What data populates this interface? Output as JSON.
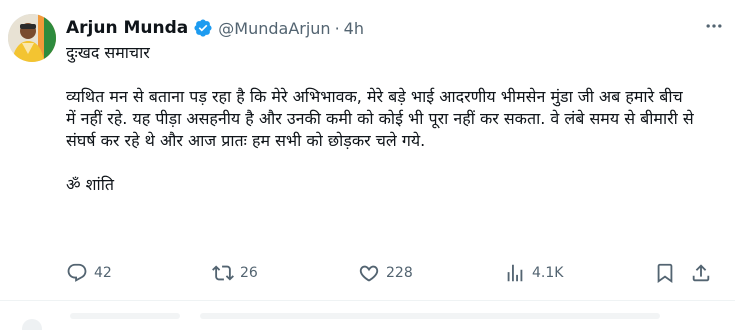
{
  "tweet": {
    "author_name": "Arjun Munda",
    "handle": "@MundaArjun",
    "separator": "·",
    "time": "4h",
    "more_icon": "more-dots-icon",
    "heading": "दुःखद समाचार",
    "paragraph1": "व्यथित मन से बताना पड़ रहा है कि मेरे अभिभावक, मेरे बड़े भाई आदरणीय भीमसेन मुंडा जी अब हमारे बीच में नहीं रहे. यह पीड़ा असहनीय है और उनकी कमी को कोई भी पूरा नहीं कर सकता. वे लंबे समय से बीमारी से संघर्ष कर रहे थे और आज प्रातः हम सभी को छोड़कर चले गये.",
    "paragraph2": "ॐ शांति",
    "verified_color": "#1d9bf0"
  },
  "actions": {
    "reply_count": "42",
    "retweet_count": "26",
    "like_count": "228",
    "views_count": "4.1K"
  },
  "colors": {
    "text_primary": "#0f1419",
    "text_secondary": "#536471",
    "divider": "#eff3f4"
  }
}
